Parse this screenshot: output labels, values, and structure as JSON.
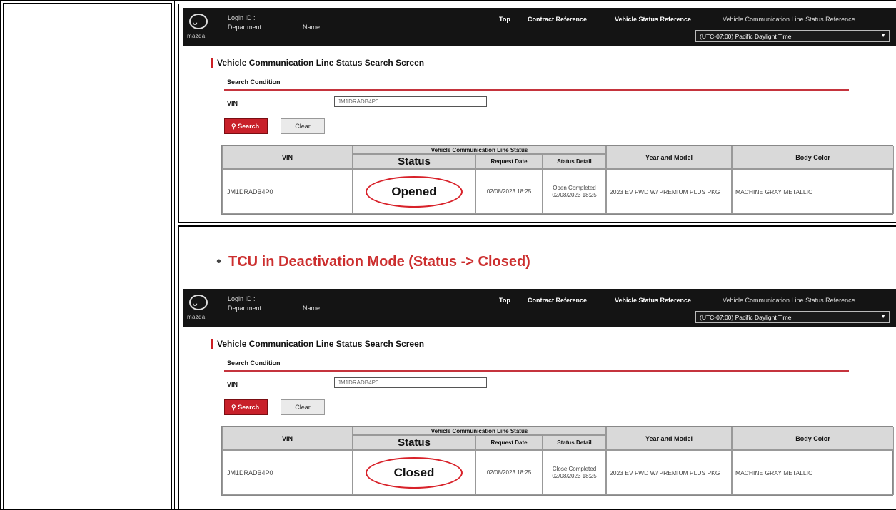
{
  "section_heading": "TCU in Deactivation Mode (Status -> Closed)",
  "screens": [
    {
      "header": {
        "brand": "mazda",
        "login_label": "Login ID :",
        "department_label": "Department :",
        "name_label": "Name :",
        "nav": [
          "Top",
          "Contract Reference",
          "Vehicle Status Reference",
          "Vehicle Communication Line Status Reference"
        ],
        "timezone": "(UTC-07:00) Pacific Daylight Time"
      },
      "title": "Vehicle Communication Line Status Search Screen",
      "search_condition_label": "Search Condition",
      "vin_label": "VIN",
      "vin_value": "JM1DRADB4P0",
      "search_button": "Search",
      "clear_button": "Clear",
      "table": {
        "headers": {
          "vin": "VIN",
          "group": "Vehicle Communication Line Status",
          "status": "Status",
          "request_date": "Request Date",
          "status_detail": "Status Detail",
          "year_model": "Year and Model",
          "body_color": "Body Color"
        },
        "row": {
          "vin": "JM1DRADB4P0",
          "status": "Opened",
          "request_date": "02/08/2023 18:25",
          "status_detail": "Open Completed 02/08/2023 18:25",
          "year_model": "2023 EV FWD W/ PREMIUM PLUS PKG",
          "body_color": "MACHINE GRAY METALLIC"
        }
      }
    },
    {
      "header": {
        "brand": "mazda",
        "login_label": "Login ID :",
        "department_label": "Department :",
        "name_label": "Name :",
        "nav": [
          "Top",
          "Contract Reference",
          "Vehicle Status Reference",
          "Vehicle Communication Line Status Reference"
        ],
        "timezone": "(UTC-07:00) Pacific Daylight Time"
      },
      "title": "Vehicle Communication Line Status Search Screen",
      "search_condition_label": "Search Condition",
      "vin_label": "VIN",
      "vin_value": "JM1DRADB4P0",
      "search_button": "Search",
      "clear_button": "Clear",
      "table": {
        "headers": {
          "vin": "VIN",
          "group": "Vehicle Communication Line Status",
          "status": "Status",
          "request_date": "Request Date",
          "status_detail": "Status Detail",
          "year_model": "Year and Model",
          "body_color": "Body Color"
        },
        "row": {
          "vin": "JM1DRADB4P0",
          "status": "Closed",
          "request_date": "02/08/2023 18:25",
          "status_detail": "Close Completed 02/08/2023 18:25",
          "year_model": "2023 EV FWD W/ PREMIUM PLUS PKG",
          "body_color": "MACHINE GRAY METALLIC"
        }
      }
    }
  ]
}
